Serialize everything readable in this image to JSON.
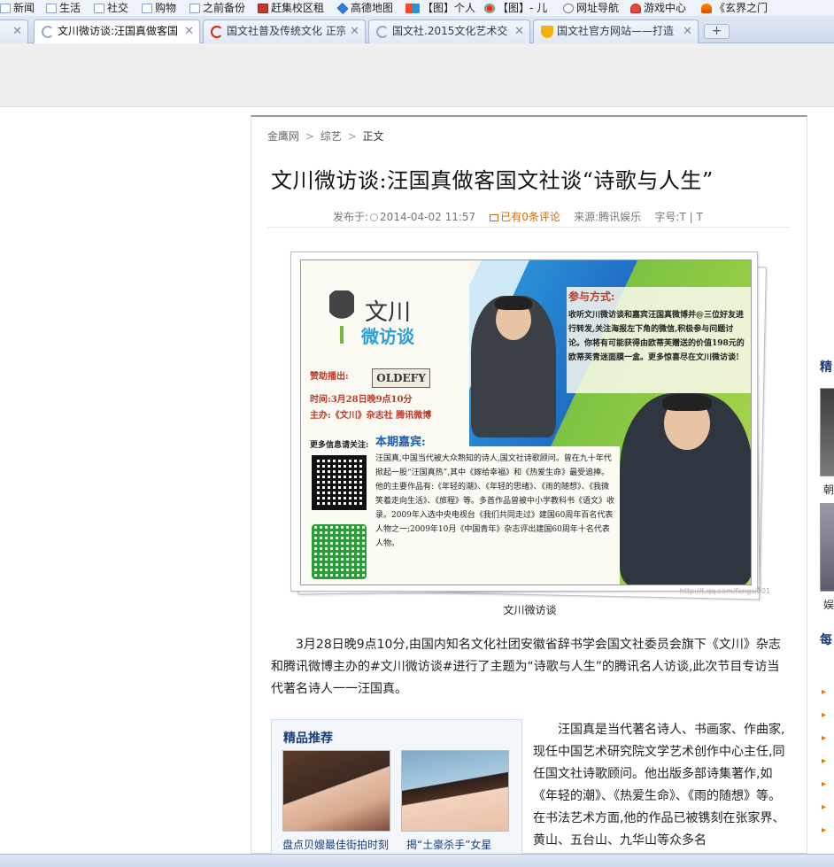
{
  "bookmarks": [
    {
      "label": "新闻",
      "icon": "folder-icon"
    },
    {
      "label": "生活",
      "icon": "folder-icon"
    },
    {
      "label": "社交",
      "icon": "folder-icon"
    },
    {
      "label": "购物",
      "icon": "folder-icon"
    },
    {
      "label": "之前备份",
      "icon": "folder-icon"
    },
    {
      "label": "赶集校区租",
      "icon": "ganji-icon"
    },
    {
      "label": "高德地图",
      "icon": "map-icon"
    },
    {
      "label": "【图】个人",
      "icon": "58-icon"
    },
    {
      "label": "【图】- 儿",
      "icon": "pinwheel-icon"
    },
    {
      "label": "网址导航",
      "icon": "globe-icon"
    },
    {
      "label": "游戏中心",
      "icon": "heart-icon"
    },
    {
      "label": "《玄界之门",
      "icon": "flame-icon"
    }
  ],
  "tabs": [
    {
      "label": "文川微访谈:汪国真做客国",
      "active": true
    },
    {
      "label": "国文社普及传统文化 正宗",
      "active": false
    },
    {
      "label": "国文社.2015文化艺术交",
      "active": false
    },
    {
      "label": "国文社官方网站——打造",
      "active": false
    }
  ],
  "breadcrumb": {
    "home": "金鹰网",
    "section": "综艺",
    "current": "正文",
    "sep": ">"
  },
  "article": {
    "title": "文川微访谈:汪国真做客国文社谈“诗歌与人生”",
    "meta": {
      "published_label": "发布于:",
      "date": "2014-04-02 11:57",
      "comments": "已有0条评论",
      "source_label": "来源:",
      "source": "腾讯娱乐",
      "fontsize_label": "字号:",
      "fontsize_options": "T | T"
    },
    "poster": {
      "logo_top": "文川",
      "logo_bottom": "微访谈",
      "sponsor_label": "赞助播出:",
      "sponsor_brand": "OLDEFY",
      "time_line": "时间:3月28日晚9点10分",
      "host_line": "主办:《文川》杂志社  腾讯微博",
      "participate_title": "参与方式:",
      "participate_text": "收听文川微访谈和嘉宾汪国真微博并@三位好友进行转发,关注海报左下角的微信,积极参与问题讨论。你将有可能获得由欧蒂芙赠送的价值198元的欧蒂芙青迷面膜一盒。更多惊喜尽在文川微访谈!",
      "more_info": "更多信息请关注:",
      "guest_title": "本期嘉宾:",
      "guest_text": "汪国真,中国当代被大众熟知的诗人,国文社诗歌顾问。曾在九十年代掀起一股“汪国真热”,其中《嫁给幸福》和《热爱生命》最受追捧。他的主要作品有:《年轻的潮》、《年轻的思绪》、《雨的随想》、《我微笑着走向生活》、《旅程》等。多首作品曾被中小学教科书《语文》收录。2009年入选中央电视台《我们共同走过》建国60周年百名代表人物之一;2009年10月《中国青年》杂志评出建国60周年十名代表人物。",
      "watermark": "http://t.qq.com/fangsi001"
    },
    "caption": "文川微访谈",
    "paragraph1": "3月28日晚9点10分,由国内知名文化社团安徽省辞书学会国文社委员会旗下《文川》杂志和腾讯微博主办的#文川微访谈#进行了主题为“诗歌与人生”的腾讯名人访谈,此次节目专访当代著名诗人一一汪国真。",
    "paragraph2": "汪国真是当代著名诗人、书画家、作曲家,现任中国艺术研究院文学艺术创作中心主任,同任国文社诗歌顾问。他出版多部诗集著作,如《年轻的潮》、《热爱生命》、《雨的随想》等。在书法艺术方面,他的作品已被镌刻在张家界、黄山、五台山、九华山等众多名"
  },
  "recommend": {
    "title": "精品推荐",
    "items": [
      {
        "caption": "盘点贝嫂最佳街拍时刻"
      },
      {
        "caption": "揭“土豪杀手”女星"
      }
    ]
  },
  "sidebar": {
    "head1": "精",
    "cap1": "朝",
    "cap2": "娱",
    "head2": "每",
    "arrows": [
      "▸",
      "▸",
      "▸",
      "▸",
      "▸",
      "▸",
      "▸",
      "▸"
    ],
    "letters": [
      "",
      "",
      "",
      "",
      "",
      "",
      "",
      ""
    ]
  }
}
